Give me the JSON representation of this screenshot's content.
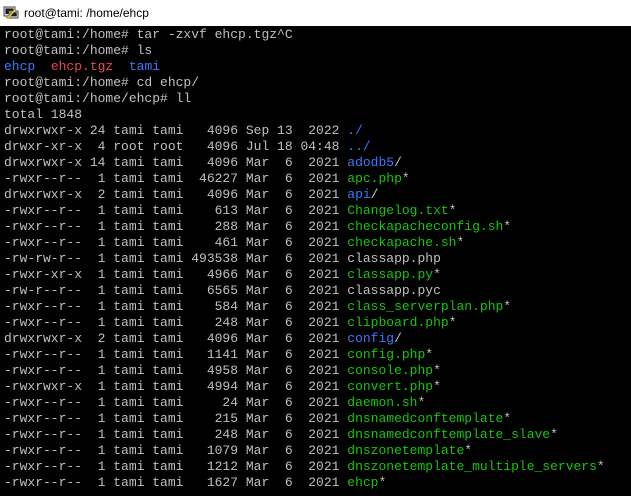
{
  "window": {
    "title": "root@tami: /home/ehcp",
    "icon": "putty-terminal-icon"
  },
  "colors": {
    "background": "#000000",
    "text": "#c0c0c0",
    "directory": "#3b78ff",
    "executable": "#16c60c",
    "archive": "#e74856"
  },
  "terminal": {
    "lines": [
      [
        {
          "t": "root@tami:/home# tar -zxvf ehcp.tgz^C",
          "c": "plain"
        }
      ],
      [
        {
          "t": "root@tami:/home# ls",
          "c": "plain"
        }
      ],
      [
        {
          "t": "ehcp",
          "c": "dir"
        },
        {
          "t": "  ",
          "c": "plain"
        },
        {
          "t": "ehcp.tgz",
          "c": "arch"
        },
        {
          "t": "  ",
          "c": "plain"
        },
        {
          "t": "tami",
          "c": "dir"
        }
      ],
      [
        {
          "t": "root@tami:/home# cd ehcp/",
          "c": "plain"
        }
      ],
      [
        {
          "t": "root@tami:/home/ehcp# ll",
          "c": "plain"
        }
      ],
      [
        {
          "t": "total 1848",
          "c": "plain"
        }
      ],
      [
        {
          "t": "drwxrwxr-x 24 tami tami   4096 Sep 13  2022 ",
          "c": "plain"
        },
        {
          "t": "./",
          "c": "dir"
        }
      ],
      [
        {
          "t": "drwxr-xr-x  4 root root   4096 Jul 18 04:48 ",
          "c": "plain"
        },
        {
          "t": "../",
          "c": "dir"
        }
      ],
      [
        {
          "t": "drwxrwxr-x 14 tami tami   4096 Mar  6  2021 ",
          "c": "plain"
        },
        {
          "t": "adodb5",
          "c": "dir"
        },
        {
          "t": "/",
          "c": "plain"
        }
      ],
      [
        {
          "t": "-rwxr--r--  1 tami tami  46227 Mar  6  2021 ",
          "c": "plain"
        },
        {
          "t": "apc.php",
          "c": "exec"
        },
        {
          "t": "*",
          "c": "plain"
        }
      ],
      [
        {
          "t": "drwxrwxr-x  2 tami tami   4096 Mar  6  2021 ",
          "c": "plain"
        },
        {
          "t": "api",
          "c": "dir"
        },
        {
          "t": "/",
          "c": "plain"
        }
      ],
      [
        {
          "t": "-rwxr--r--  1 tami tami    613 Mar  6  2021 ",
          "c": "plain"
        },
        {
          "t": "Changelog.txt",
          "c": "exec"
        },
        {
          "t": "*",
          "c": "plain"
        }
      ],
      [
        {
          "t": "-rwxr--r--  1 tami tami    288 Mar  6  2021 ",
          "c": "plain"
        },
        {
          "t": "checkapacheconfig.sh",
          "c": "exec"
        },
        {
          "t": "*",
          "c": "plain"
        }
      ],
      [
        {
          "t": "-rwxr--r--  1 tami tami    461 Mar  6  2021 ",
          "c": "plain"
        },
        {
          "t": "checkapache.sh",
          "c": "exec"
        },
        {
          "t": "*",
          "c": "plain"
        }
      ],
      [
        {
          "t": "-rw-rw-r--  1 tami tami 493538 Mar  6  2021 classapp.php",
          "c": "plain"
        }
      ],
      [
        {
          "t": "-rwxr-xr-x  1 tami tami   4966 Mar  6  2021 ",
          "c": "plain"
        },
        {
          "t": "classapp.py",
          "c": "exec"
        },
        {
          "t": "*",
          "c": "plain"
        }
      ],
      [
        {
          "t": "-rw-r--r--  1 tami tami   6565 Mar  6  2021 classapp.pyc",
          "c": "plain"
        }
      ],
      [
        {
          "t": "-rwxr--r--  1 tami tami    584 Mar  6  2021 ",
          "c": "plain"
        },
        {
          "t": "class_serverplan.php",
          "c": "exec"
        },
        {
          "t": "*",
          "c": "plain"
        }
      ],
      [
        {
          "t": "-rwxr--r--  1 tami tami    248 Mar  6  2021 ",
          "c": "plain"
        },
        {
          "t": "clipboard.php",
          "c": "exec"
        },
        {
          "t": "*",
          "c": "plain"
        }
      ],
      [
        {
          "t": "drwxrwxr-x  2 tami tami   4096 Mar  6  2021 ",
          "c": "plain"
        },
        {
          "t": "config",
          "c": "dir"
        },
        {
          "t": "/",
          "c": "plain"
        }
      ],
      [
        {
          "t": "-rwxr--r--  1 tami tami   1141 Mar  6  2021 ",
          "c": "plain"
        },
        {
          "t": "config.php",
          "c": "exec"
        },
        {
          "t": "*",
          "c": "plain"
        }
      ],
      [
        {
          "t": "-rwxr--r--  1 tami tami   4958 Mar  6  2021 ",
          "c": "plain"
        },
        {
          "t": "console.php",
          "c": "exec"
        },
        {
          "t": "*",
          "c": "plain"
        }
      ],
      [
        {
          "t": "-rwxrwxr-x  1 tami tami   4994 Mar  6  2021 ",
          "c": "plain"
        },
        {
          "t": "convert.php",
          "c": "exec"
        },
        {
          "t": "*",
          "c": "plain"
        }
      ],
      [
        {
          "t": "-rwxr--r--  1 tami tami     24 Mar  6  2021 ",
          "c": "plain"
        },
        {
          "t": "daemon.sh",
          "c": "exec"
        },
        {
          "t": "*",
          "c": "plain"
        }
      ],
      [
        {
          "t": "-rwxr--r--  1 tami tami    215 Mar  6  2021 ",
          "c": "plain"
        },
        {
          "t": "dnsnamedconftemplate",
          "c": "exec"
        },
        {
          "t": "*",
          "c": "plain"
        }
      ],
      [
        {
          "t": "-rwxr--r--  1 tami tami    248 Mar  6  2021 ",
          "c": "plain"
        },
        {
          "t": "dnsnamedconftemplate_slave",
          "c": "exec"
        },
        {
          "t": "*",
          "c": "plain"
        }
      ],
      [
        {
          "t": "-rwxr--r--  1 tami tami   1079 Mar  6  2021 ",
          "c": "plain"
        },
        {
          "t": "dnszonetemplate",
          "c": "exec"
        },
        {
          "t": "*",
          "c": "plain"
        }
      ],
      [
        {
          "t": "-rwxr--r--  1 tami tami   1212 Mar  6  2021 ",
          "c": "plain"
        },
        {
          "t": "dnszonetemplate_multiple_servers",
          "c": "exec"
        },
        {
          "t": "*",
          "c": "plain"
        }
      ],
      [
        {
          "t": "-rwxr--r--  1 tami tami   1627 Mar  6  2021 ",
          "c": "plain"
        },
        {
          "t": "ehcp",
          "c": "exec"
        },
        {
          "t": "*",
          "c": "plain"
        }
      ]
    ]
  }
}
